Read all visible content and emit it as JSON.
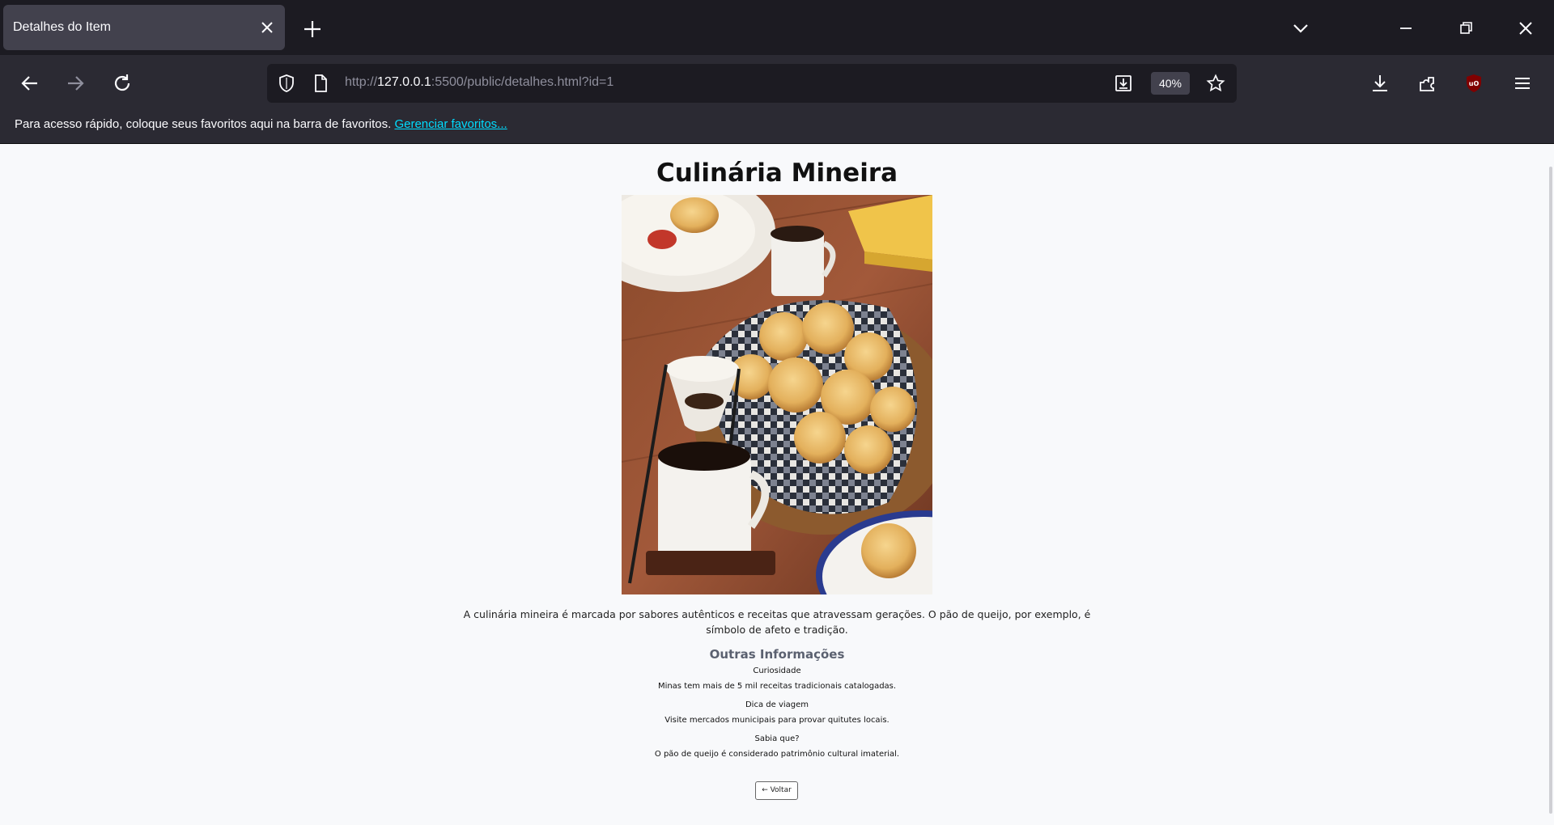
{
  "browser": {
    "tab_title": "Detalhes do Item",
    "url_prefix": "http://",
    "url_host": "127.0.0.1",
    "url_rest": ":5500/public/detalhes.html?id=1",
    "zoom": "40%",
    "bookmarks_text": "Para acesso rápido, coloque seus favoritos aqui na barra de favoritos.",
    "bookmarks_link": "Gerenciar favoritos..."
  },
  "page": {
    "title": "Culinária Mineira",
    "image_alt": "Pão de queijo com café",
    "description": "A culinária mineira é marcada por sabores autênticos e receitas que atravessam gerações. O pão de queijo, por exemplo, é símbolo de afeto e tradição.",
    "info_heading": "Outras Informações",
    "info": [
      {
        "label": "Curiosidade",
        "text": "Minas tem mais de 5 mil receitas tradicionais catalogadas."
      },
      {
        "label": "Dica de viagem",
        "text": "Visite mercados municipais para provar quitutes locais."
      },
      {
        "label": "Sabia que?",
        "text": "O pão de queijo é considerado patrimônio cultural imaterial."
      }
    ],
    "back_button": "← Voltar"
  },
  "colors": {
    "titlebar": "#1c1b22",
    "toolbar": "#2b2a33",
    "accent_link": "#00ddff",
    "page_bg": "#f8f9fb"
  }
}
